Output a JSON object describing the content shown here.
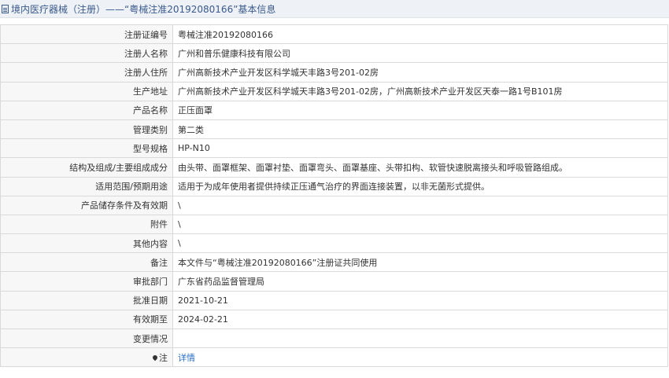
{
  "header": {
    "title": "境内医疗器械（注册）——“粤械注准20192080166”基本信息"
  },
  "rows": [
    {
      "label": "注册证编号",
      "value": "粤械注准20192080166"
    },
    {
      "label": "注册人名称",
      "value": "广州和普乐健康科技有限公司"
    },
    {
      "label": "注册人住所",
      "value": "广州高新技术产业开发区科学城天丰路3号201-02房"
    },
    {
      "label": "生产地址",
      "value": "广州高新技术产业开发区科学城天丰路3号201-02房，广州高新技术产业开发区天泰一路1号B101房"
    },
    {
      "label": "产品名称",
      "value": "正压面罩"
    },
    {
      "label": "管理类别",
      "value": "第二类"
    },
    {
      "label": "型号规格",
      "value": "HP-N10"
    },
    {
      "label": "结构及组成/主要组成成分",
      "value": "由头带、面罩框架、面罩衬垫、面罩弯头、面罩基座、头带扣构、软管快速脱离接头和呼吸管路组成。"
    },
    {
      "label": "适用范围/预期用途",
      "value": "适用于为成年使用者提供持续正压通气治疗的界面连接装置，以非无菌形式提供。"
    },
    {
      "label": "产品储存条件及有效期",
      "value": "\\"
    },
    {
      "label": "附件",
      "value": "\\"
    },
    {
      "label": "其他内容",
      "value": "\\"
    },
    {
      "label": "备注",
      "value": "本文件与“粤械注准20192080166”注册证共同使用"
    },
    {
      "label": "审批部门",
      "value": "广东省药品监督管理局"
    },
    {
      "label": "批准日期",
      "value": "2021-10-21"
    },
    {
      "label": "有效期至",
      "value": "2024-02-21"
    },
    {
      "label": "变更情况",
      "value": ""
    }
  ],
  "note": {
    "label": "注",
    "value": "详情"
  }
}
